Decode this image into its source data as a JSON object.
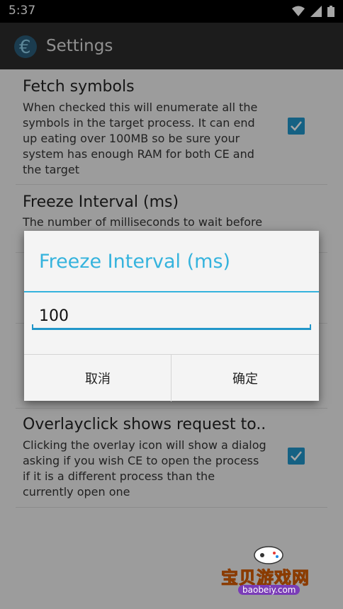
{
  "status_bar": {
    "time": "5:37"
  },
  "app_bar": {
    "title": "Settings"
  },
  "preferences": [
    {
      "title": "Fetch symbols",
      "summary": "When checked this will enumerate all the symbols in the target process. It can end up eating over 100MB so be sure your system has enough RAM for both CE and the target",
      "checked": true
    },
    {
      "title": "Freeze Interval (ms)",
      "summary": "The number of milliseconds to wait before"
    },
    {
      "title": "Overlayclick shows request to..",
      "summary": "Clicking the overlay icon will show a dialog asking if you wish CE to open the process if it is a different process than the currently open one",
      "checked": true
    }
  ],
  "dialog": {
    "title": "Freeze Interval (ms)",
    "input_value": "100",
    "cancel_label": "取消",
    "ok_label": "确定"
  },
  "watermark": {
    "text": "宝贝游戏网",
    "url": "baobeiy.com"
  },
  "colors": {
    "accent": "#35b3dd",
    "checkbox": "#2196c9",
    "app_bar": "#2b2b2b"
  }
}
